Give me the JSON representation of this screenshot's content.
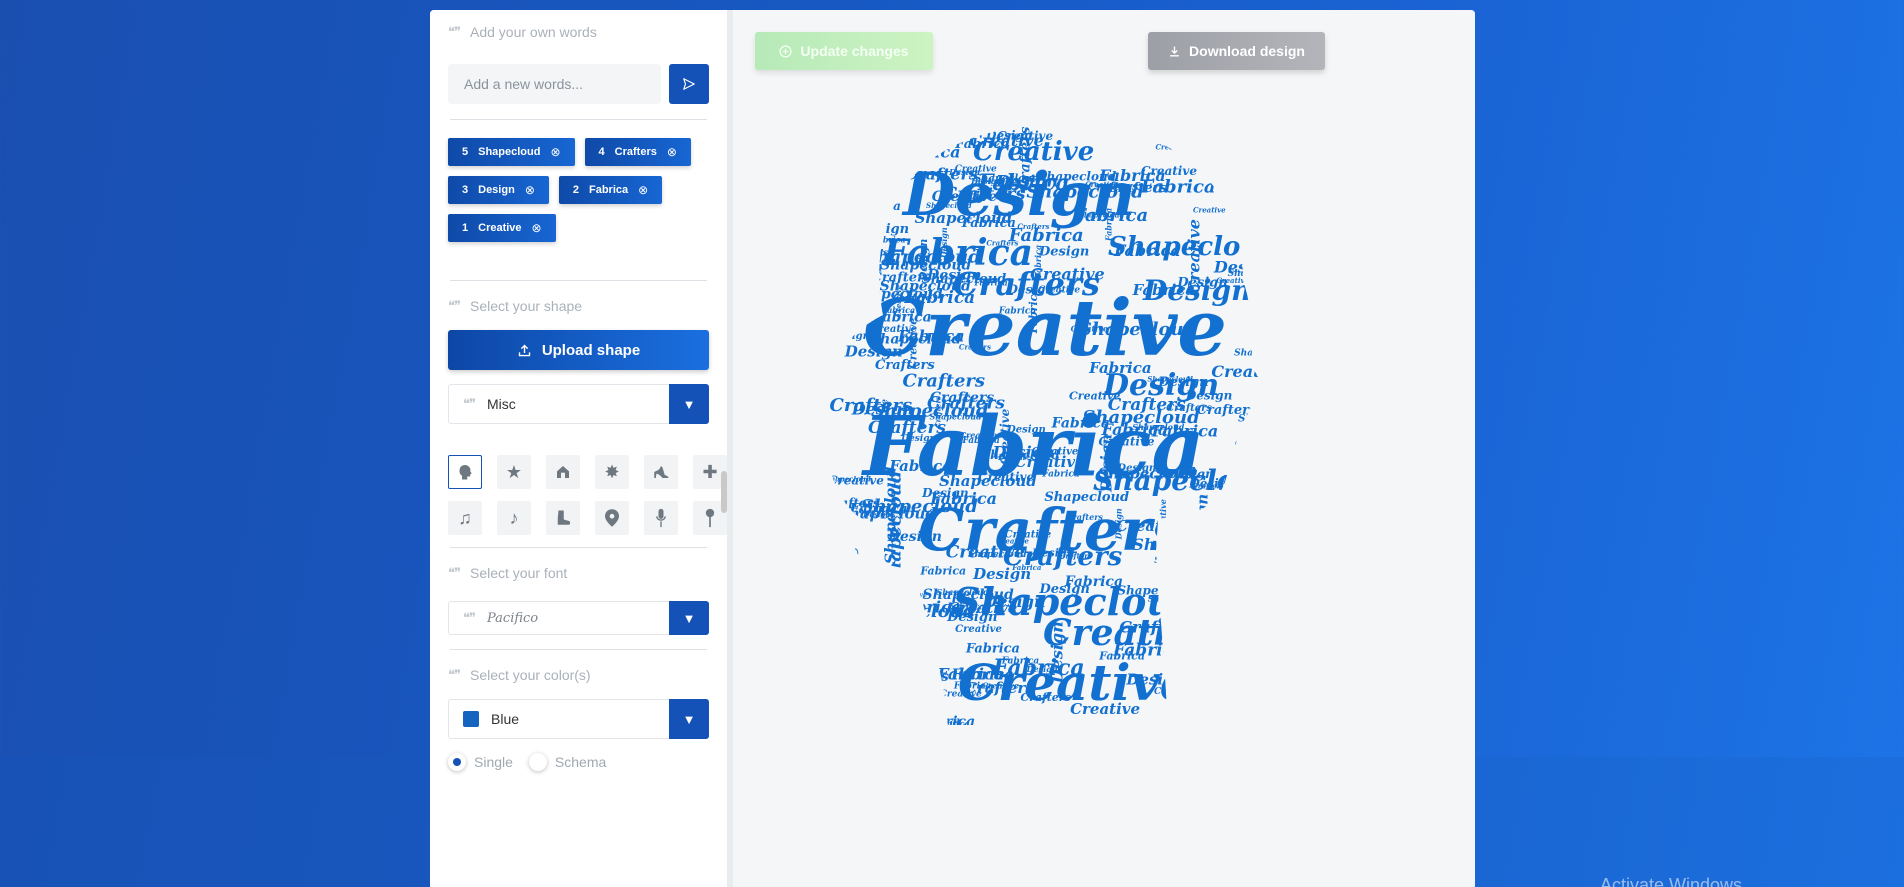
{
  "words_section": {
    "title": "Add your own words",
    "input_placeholder": "Add a new words...",
    "chips": [
      {
        "count": "5",
        "word": "Shapecloud"
      },
      {
        "count": "4",
        "word": "Crafters"
      },
      {
        "count": "3",
        "word": "Design"
      },
      {
        "count": "2",
        "word": "Fabrica"
      },
      {
        "count": "1",
        "word": "Creative"
      }
    ]
  },
  "shape_section": {
    "title": "Select your shape",
    "upload_label": "Upload shape",
    "category": "Misc",
    "shapes": [
      "head-icon",
      "star-icon",
      "house-icon",
      "sun-icon",
      "high-heel-icon",
      "plus-icon",
      "music-notes-icon",
      "music-note-icon",
      "boot-icon",
      "map-pin-icon",
      "microphone-icon",
      "push-pin-icon"
    ],
    "selected_shape": "head-icon"
  },
  "font_section": {
    "title": "Select your font",
    "value": "Pacifico"
  },
  "color_section": {
    "title": "Select your color(s)",
    "value": "Blue",
    "swatch": "#1565c0",
    "mode_single": "Single",
    "mode_schema": "Schema",
    "selected_mode": "Single"
  },
  "toolbar": {
    "update_label": "Update changes",
    "download_label": "Download design"
  },
  "cloud": {
    "words": [
      "Creative",
      "Fabrica",
      "Crafters",
      "Shapecloud",
      "Design"
    ],
    "color": "#1270d0"
  },
  "watermark": "Activate Windows"
}
